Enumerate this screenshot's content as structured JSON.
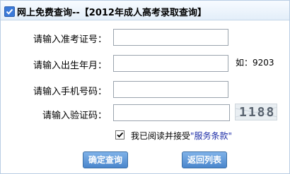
{
  "header": {
    "title": "网上免费查询--【2012年成人高考录取查询】",
    "icon": "checkbox-checked-icon",
    "accent_color": "#3a79d8"
  },
  "form": {
    "exam_number": {
      "label": "请输入准考证号：",
      "value": ""
    },
    "birth_month": {
      "label": "请输入出生年月：",
      "value": "",
      "hint": "如：9203"
    },
    "phone": {
      "label": "请输入手机号码：",
      "value": ""
    },
    "captcha": {
      "label": "请输入验证码：",
      "value": "",
      "image_text": "1188"
    }
  },
  "agreement": {
    "checked": true,
    "label": "我已阅读并接受",
    "link": "\"服务条款\"",
    "link_color": "#1f2fa8"
  },
  "buttons": {
    "confirm": "确定查询",
    "back": "返回列表",
    "color": "#4a86cc"
  }
}
